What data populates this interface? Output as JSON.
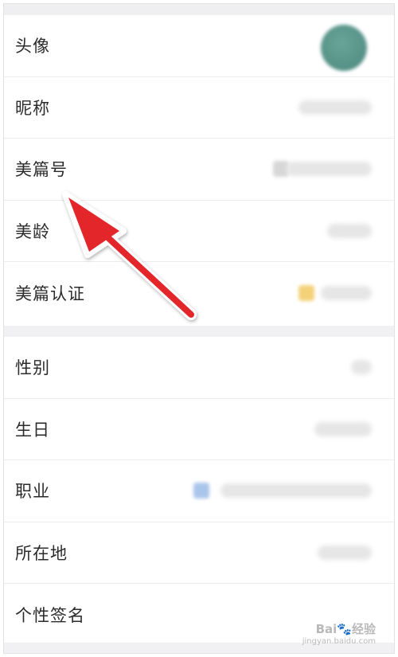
{
  "group1": [
    {
      "label": "头像"
    },
    {
      "label": "昵称"
    },
    {
      "label": "美篇号"
    },
    {
      "label": "美龄"
    },
    {
      "label": "美篇认证"
    }
  ],
  "group2": [
    {
      "label": "性别"
    },
    {
      "label": "生日"
    },
    {
      "label": "职业"
    },
    {
      "label": "所在地"
    },
    {
      "label": "个性签名"
    }
  ],
  "colors": {
    "arrow": "#e3262b",
    "avatar": "#5b968b",
    "separator_background": "#f1f1f3"
  },
  "watermark": {
    "main": "Bai🐾经验",
    "sub": "jingyan.baidu.com"
  }
}
